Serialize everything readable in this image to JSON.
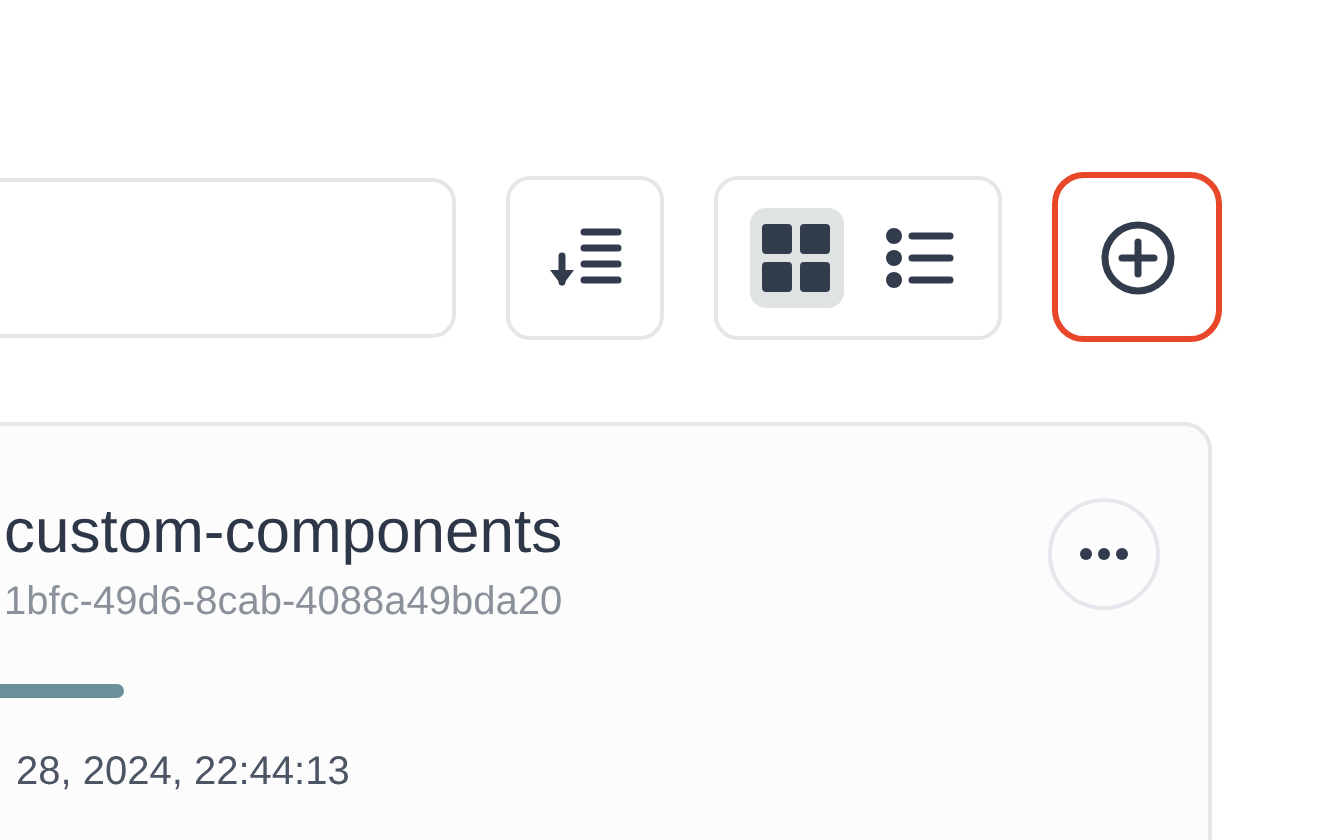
{
  "toolbar": {
    "sort_button": {
      "kind": "sort"
    },
    "view_options": [
      {
        "kind": "grid",
        "selected": true
      },
      {
        "kind": "list",
        "selected": false
      }
    ],
    "add_button": {
      "highlighted": true
    }
  },
  "card": {
    "title": "custom-components",
    "id": "1bfc-49d6-8cab-4088a49bda20",
    "date": "28, 2024, 22:44:13"
  }
}
